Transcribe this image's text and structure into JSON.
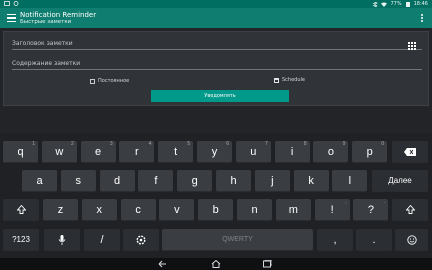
{
  "status": {
    "battery": "77%",
    "time": "18:46"
  },
  "app": {
    "title": "Notification Reminder",
    "subtitle": "Быстрые заметки"
  },
  "form": {
    "title_placeholder": "Заголовок заметки",
    "body_placeholder": "Содержание заметки",
    "persistent_label": "Постоянное",
    "schedule_label": "Schedule",
    "notify_button": "Уведомлять"
  },
  "keyboard": {
    "row1": [
      {
        "label": "q",
        "hint": "1"
      },
      {
        "label": "w",
        "hint": "2"
      },
      {
        "label": "e",
        "hint": "3"
      },
      {
        "label": "r",
        "hint": "4"
      },
      {
        "label": "t",
        "hint": "5"
      },
      {
        "label": "y",
        "hint": "6"
      },
      {
        "label": "u",
        "hint": "7"
      },
      {
        "label": "i",
        "hint": "8"
      },
      {
        "label": "o",
        "hint": "9"
      },
      {
        "label": "p",
        "hint": "0"
      }
    ],
    "row2": [
      "a",
      "s",
      "d",
      "f",
      "g",
      "h",
      "j",
      "k",
      "l"
    ],
    "row3": [
      {
        "label": "z",
        "hint": ""
      },
      {
        "label": "x",
        "hint": ""
      },
      {
        "label": "c",
        "hint": ""
      },
      {
        "label": "v",
        "hint": ""
      },
      {
        "label": "b",
        "hint": ""
      },
      {
        "label": "n",
        "hint": ""
      },
      {
        "label": "m",
        "hint": ""
      },
      {
        "label": "!",
        "hint": ","
      },
      {
        "label": "?",
        "hint": "."
      }
    ],
    "numbers_key": "?123",
    "slash_key": "/",
    "comma_key": ",",
    "period_key": ".",
    "space_label": "QWERTY",
    "enter_key": "Далее"
  },
  "icons": {
    "menu": "menu-icon",
    "overflow": "overflow-menu-icon",
    "grid": "grid-icon",
    "calendar": "calendar-icon",
    "backspace": "backspace-icon",
    "shift": "shift-icon",
    "mic": "mic-icon",
    "settings": "settings-icon",
    "emoji": "emoji-icon",
    "back": "back-icon",
    "home": "home-icon",
    "recents": "recents-icon"
  },
  "colors": {
    "status_bar": "#006f62",
    "app_bar": "#0f7d70",
    "button": "#00998a"
  }
}
